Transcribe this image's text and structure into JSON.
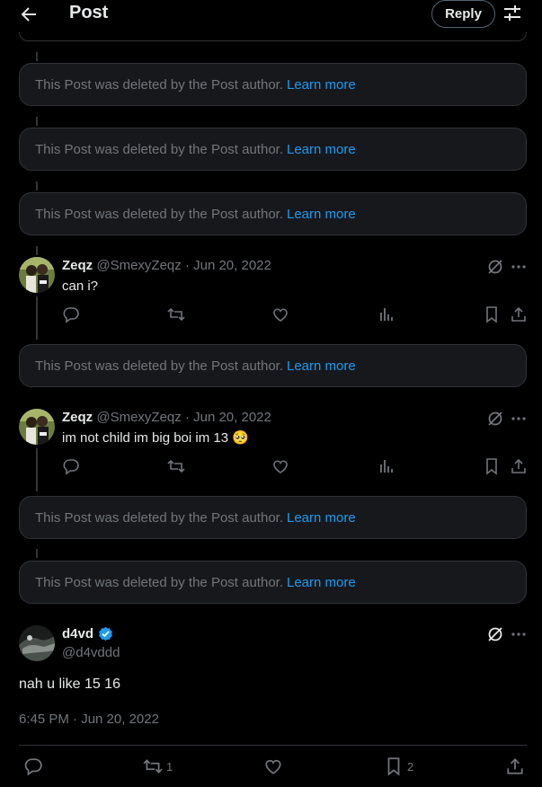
{
  "header": {
    "title": "Post",
    "reply_label": "Reply",
    "back_icon": "arrow-left-icon",
    "settings_icon": "sliders-icon"
  },
  "deleted_notice": {
    "text": "This Post was deleted by the Post author.",
    "link": "Learn more"
  },
  "replies": [
    {
      "name": "Zeqz",
      "handle": "@SmexyZeqz",
      "separator": "·",
      "date": "Jun 20, 2022",
      "text": "can i?"
    },
    {
      "name": "Zeqz",
      "handle": "@SmexyZeqz",
      "separator": "·",
      "date": "Jun 20, 2022",
      "text": "im not child im big boi im 13 🥺"
    }
  ],
  "main_post": {
    "name": "d4vd",
    "handle": "@d4vddd",
    "text": "nah u like 15 16",
    "timestamp": "6:45 PM · Jun 20, 2022",
    "retweet_count": "1",
    "bookmark_count": "2",
    "verified": true
  },
  "colors": {
    "accent": "#1d9bf0",
    "background": "#000000",
    "card": "#16181c",
    "muted": "#71767b",
    "border": "#2f3336"
  }
}
